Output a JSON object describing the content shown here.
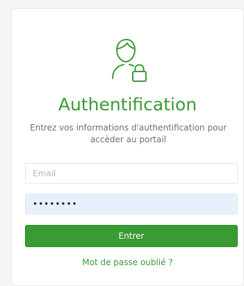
{
  "login": {
    "icon": "user-lock-icon",
    "title": "Authentification",
    "subtitle": "Entrez vos informations d'authentification pour accèder au portail",
    "email_placeholder": "Email",
    "email_value": "",
    "password_value": "••••••••",
    "submit_label": "Entrer",
    "forgot_label": "Mot de passe oublié ?"
  },
  "colors": {
    "accent": "#3c9a36",
    "button_bg": "#3a9a34",
    "autofill_bg": "#e8f0fe"
  }
}
